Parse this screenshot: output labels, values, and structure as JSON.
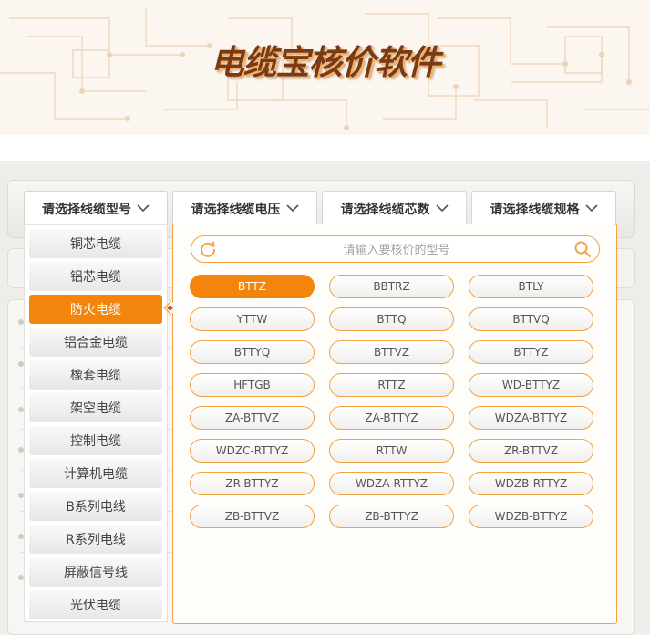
{
  "header": {
    "logo_text": "电缆宝核价软件"
  },
  "dropdowns": [
    {
      "label": "请选择线缆型号",
      "icon": "chevron-down-icon"
    },
    {
      "label": "请选择线缆电压",
      "icon": "chevron-down-icon"
    },
    {
      "label": "请选择线缆芯数",
      "icon": "chevron-down-icon"
    },
    {
      "label": "请选择线缆规格",
      "icon": "chevron-down-icon"
    }
  ],
  "categories": {
    "selected": "防火电缆",
    "items": [
      "铜芯电缆",
      "铝芯电缆",
      "防火电缆",
      "铝合金电缆",
      "橡套电缆",
      "架空电缆",
      "控制电缆",
      "计算机电缆",
      "B系列电线",
      "R系列电线",
      "屏蔽信号线",
      "光伏电缆"
    ]
  },
  "search": {
    "placeholder": "请输入要核价的型号",
    "left_icon": "refresh-icon",
    "right_icon": "search-icon"
  },
  "models": {
    "selected": "BTTZ",
    "items": [
      "BTTZ",
      "BBTRZ",
      "BTLY",
      "YTTW",
      "BTTQ",
      "BTTVQ",
      "BTTYQ",
      "BTTVZ",
      "BTTYZ",
      "HFTGB",
      "RTTZ",
      "WD-BTTYZ",
      "ZA-BTTVZ",
      "ZA-BTTYZ",
      "WDZA-BTTYZ",
      "WDZC-RTTYZ",
      "RTTW",
      "ZR-BTTVZ",
      "ZR-BTTYZ",
      "WDZA-RTTYZ",
      "WDZB-RTTYZ",
      "ZB-BTTVZ",
      "ZB-BTTYZ",
      "WDZB-BTTYZ"
    ]
  },
  "colors": {
    "accent": "#f3850d",
    "border_accent": "#f3a246"
  }
}
